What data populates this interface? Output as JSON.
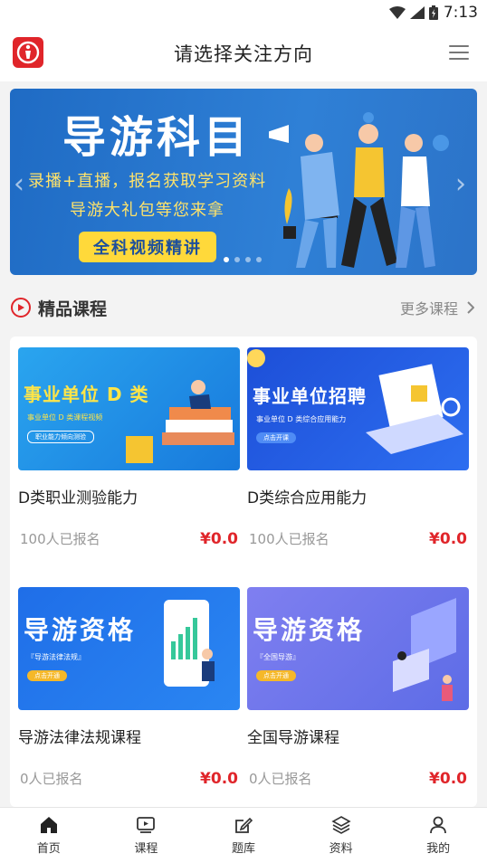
{
  "status_bar": {
    "time": "7:13"
  },
  "header": {
    "title": "请选择关注方向"
  },
  "banner": {
    "title": "导游科目",
    "line1": "录播+直播，报名获取学习资料",
    "line2": "导游大礼包等您来拿",
    "pill": "全科视频精讲",
    "slide_count": 4,
    "active_slide": 1
  },
  "section": {
    "title": "精品课程",
    "more_label": "更多课程"
  },
  "courses": [
    {
      "title": "D类职业测验能力",
      "enrolled": "100人已报名",
      "price": "¥0.0",
      "image": {
        "headline": "事业单位 D 类",
        "tag": "事业单位   D 类课程视频",
        "button": "职业能力倾向测验"
      }
    },
    {
      "title": "D类综合应用能力",
      "enrolled": "100人已报名",
      "price": "¥0.0",
      "image": {
        "headline": "事业单位招聘",
        "tag": "事业单位 D 类综合应用能力",
        "button": "点击开课"
      }
    },
    {
      "title": "导游法律法规课程",
      "enrolled": "0人已报名",
      "price": "¥0.0",
      "image": {
        "headline": "导游资格",
        "tag": "『导游法律法规』",
        "button": "点击开通"
      }
    },
    {
      "title": "全国导游课程",
      "enrolled": "0人已报名",
      "price": "¥0.0",
      "image": {
        "headline": "导游资格",
        "tag": "『全国导游』",
        "button": "点击开通"
      }
    }
  ],
  "tabbar": {
    "items": [
      {
        "label": "首页",
        "icon": "home-icon",
        "active": true
      },
      {
        "label": "课程",
        "icon": "video-icon",
        "active": false
      },
      {
        "label": "题库",
        "icon": "edit-icon",
        "active": false
      },
      {
        "label": "资料",
        "icon": "layers-icon",
        "active": false
      },
      {
        "label": "我的",
        "icon": "user-icon",
        "active": false
      }
    ]
  },
  "colors": {
    "accent": "#e0252a",
    "banner_blue": "#2f80d6",
    "highlight_yellow": "#ffe36a"
  }
}
